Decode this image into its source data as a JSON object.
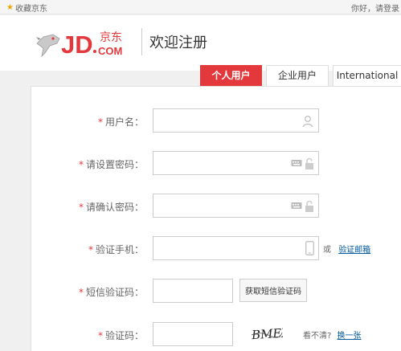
{
  "topbar": {
    "favorite_label": "收藏京东",
    "greeting": "你好，请登录"
  },
  "header": {
    "logo_text": "JD.COM",
    "logo_cn": "京东",
    "title": "欢迎注册"
  },
  "tabs": [
    {
      "label": "个人用户",
      "active": true
    },
    {
      "label": "企业用户",
      "active": false
    },
    {
      "label": "International",
      "active": false
    }
  ],
  "form": {
    "required_mark": "*",
    "username_label": "用户名：",
    "password_label": "请设置密码：",
    "confirm_label": "请确认密码：",
    "phone_label": "验证手机：",
    "phone_or": "或",
    "email_link": "验证邮箱",
    "sms_label": "短信验证码：",
    "sms_button": "获取短信验证码",
    "captcha_label": "验证码：",
    "captcha_text": "BMEX",
    "captcha_hint": "看不清?",
    "captcha_refresh": "换一张"
  },
  "colors": {
    "accent": "#e4393c",
    "link": "#005aa0"
  }
}
